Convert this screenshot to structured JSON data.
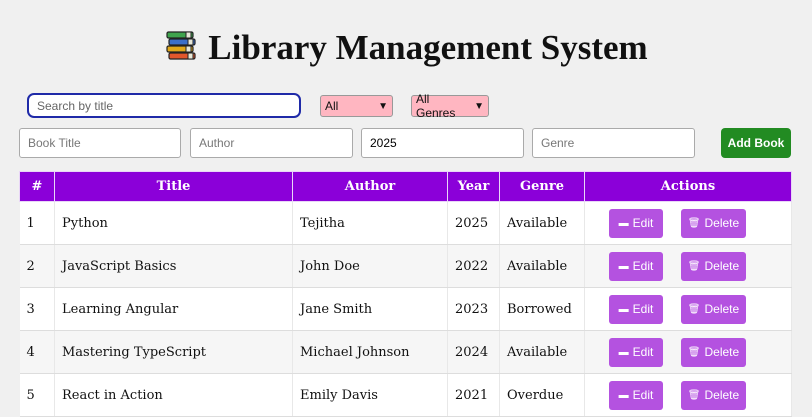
{
  "header": {
    "title": "Library Management System",
    "icon": "books-icon"
  },
  "filters": {
    "search_placeholder": "Search by title",
    "status_value": "All",
    "genre_value": "All Genres",
    "select_color": "#ffb6c1"
  },
  "form": {
    "title_placeholder": "Book Title",
    "author_placeholder": "Author",
    "year_value": "2025",
    "genre_placeholder": "Genre",
    "add_label": "Add Book",
    "add_color": "#228b22"
  },
  "table": {
    "header_color": "#8b00d9",
    "columns": [
      "#",
      "Title",
      "Author",
      "Year",
      "Genre",
      "Actions"
    ],
    "edit_label": "Edit",
    "delete_label": "Delete",
    "button_color": "#b452e0",
    "rows": [
      {
        "id": "1",
        "title": "Python",
        "author": "Tejitha",
        "year": "2025",
        "genre": "Available"
      },
      {
        "id": "2",
        "title": "JavaScript Basics",
        "author": "John Doe",
        "year": "2022",
        "genre": "Available"
      },
      {
        "id": "3",
        "title": "Learning Angular",
        "author": "Jane Smith",
        "year": "2023",
        "genre": "Borrowed"
      },
      {
        "id": "4",
        "title": "Mastering TypeScript",
        "author": "Michael Johnson",
        "year": "2024",
        "genre": "Available"
      },
      {
        "id": "5",
        "title": "React in Action",
        "author": "Emily Davis",
        "year": "2021",
        "genre": "Overdue"
      }
    ]
  }
}
